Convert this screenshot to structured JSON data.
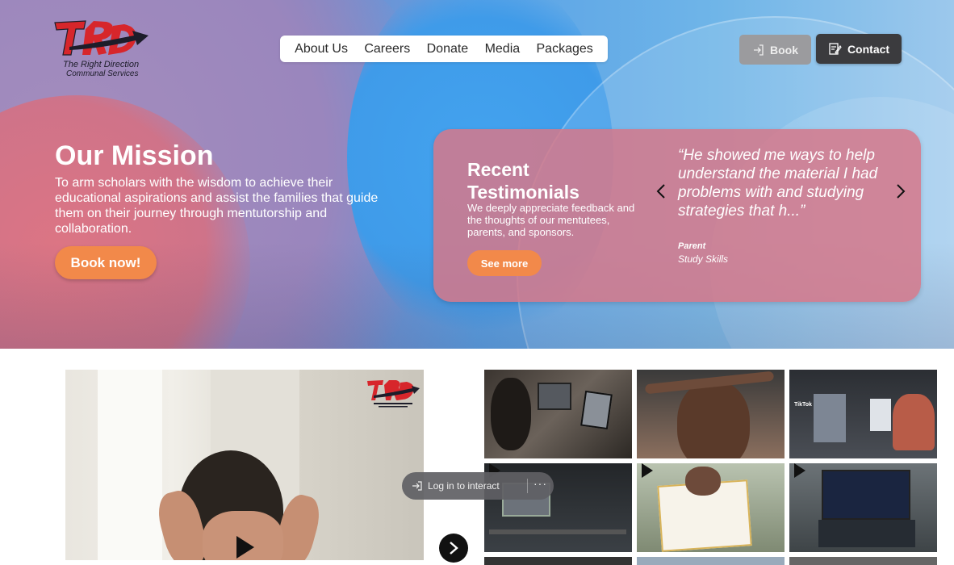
{
  "brand": {
    "logo_mark": "TRD",
    "name_line1": "The Right Direction",
    "name_line2": "Communal Services",
    "colors": {
      "red": "#d7262b",
      "dark": "#1d1d2a"
    }
  },
  "nav": {
    "items": [
      "About Us",
      "Careers",
      "Donate",
      "Media",
      "Packages"
    ]
  },
  "header_buttons": {
    "book": {
      "label": "Book",
      "icon": "login-arrow-icon"
    },
    "contact": {
      "label": "Contact",
      "icon": "edit-document-icon"
    }
  },
  "mission": {
    "title": "Our Mission",
    "body": "To arm scholars with the wisdom to achieve their educational aspirations and assist the families that guide them on their journey through mentutorship and collaboration.",
    "cta": "Book now!"
  },
  "testimonials": {
    "title": "Recent Testimonials",
    "description": "We deeply appreciate feedback and the thoughts of our mentutees, parents, and sponsors.",
    "cta": "See more",
    "quote": "“He showed me ways to help understand the material I had problems with and studying strategies that h...”",
    "author_role": "Parent",
    "author_subject": "Study Skills"
  },
  "media": {
    "next_icon": "chevron-right-icon",
    "login_prompt": "Log in to interact",
    "more_label": "···",
    "tiktok_label": "TikTok"
  },
  "colors": {
    "accent_orange": "#f2894a",
    "testimonial_bg": "#d67889",
    "contact_btn": "#3b3b3e",
    "book_btn": "#9b9b9e"
  }
}
